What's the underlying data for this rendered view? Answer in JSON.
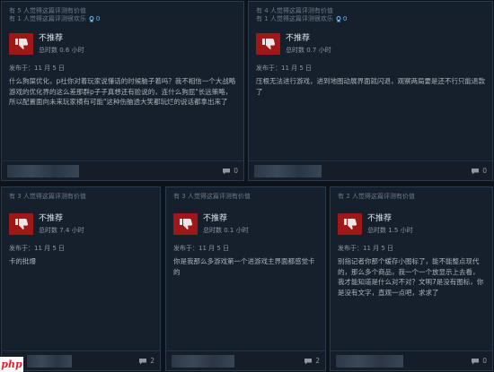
{
  "reviews": [
    {
      "helpful_line": "有 5 人觉得这篇评测有价值",
      "funny_line": "有 1 人觉得这篇评测很欢乐",
      "award_count": "0",
      "verdict": "不推荐",
      "hours": "总时数 0.6 小时",
      "posted": "发布于：11 月 5 日",
      "body": "什么狗屎优化，p社你对着玩家说懂话的时候脑子着吗？我不相信一个大战略游戏的优化界的这么差那群p子子真想还有脸说的，连什么狗屁\"长远策略，所以配置面向未来玩家横有可能\"这种伤脑透大笑都玩烂的说话都拿出来了",
      "comment_count": "0"
    },
    {
      "helpful_line": "有 4 人觉得这篇评测有价值",
      "funny_line": "有 1 人觉得这篇评测很欢乐",
      "award_count": "0",
      "verdict": "不推荐",
      "hours": "总时数 0.7 小时",
      "posted": "发布于：11 月 5 日",
      "body": "压根无法进行游戏，进到地图动展界面就闪退，观察两局要是还不行只能退款了",
      "comment_count": "0"
    },
    {
      "helpful_line": "有 3 人觉得这篇评测有价值",
      "funny_line": "",
      "award_count": "",
      "verdict": "不推荐",
      "hours": "总时数 7.4 小时",
      "posted": "发布于：11 月 5 日",
      "body": "卡的批爆",
      "comment_count": "2"
    },
    {
      "helpful_line": "有 3 人觉得这篇评测有价值",
      "funny_line": "",
      "award_count": "",
      "verdict": "不推荐",
      "hours": "总时数 0.1 小时",
      "posted": "发布于：11 月 5 日",
      "body": "你是我那么多游戏第一个进游戏主界面都感觉卡的",
      "comment_count": "2"
    },
    {
      "helpful_line": "有 2 人觉得这篇评测有价值",
      "funny_line": "",
      "award_count": "",
      "verdict": "不推荐",
      "hours": "总时数 1.5 小时",
      "posted": "发布于：11 月 5 日",
      "body": "别指记者你那个缓存小图标了，能不能整点现代的，那么多个商品，我一个一个放显示上去看，我才能知道是什么对不对？文明7是没有图标，你是没有文字，直观一点吧，求求了",
      "comment_count": "0"
    }
  ],
  "watermark": "php",
  "colors": {
    "background": "#0d131b",
    "card": "#16202d",
    "thumb_red": "#a01717",
    "award_blue": "#66c0f4"
  },
  "icons": {
    "thumb": "thumbs-down-icon",
    "award": "award-icon",
    "comment": "comment-icon"
  }
}
